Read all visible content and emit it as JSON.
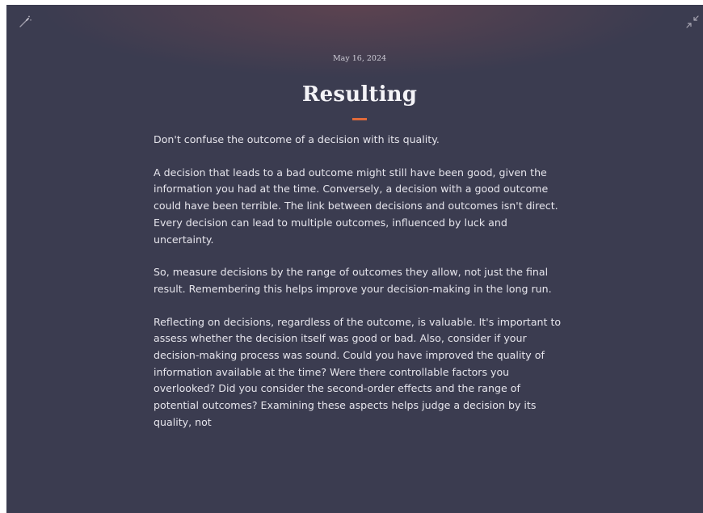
{
  "toolbar": {
    "left_icon": "magic-wand-icon",
    "right_icon": "collapse-arrows-icon"
  },
  "article": {
    "date": "May 16, 2024",
    "title": "Resulting",
    "divider_color": "#e06a3a",
    "paragraphs": [
      "Don't confuse the outcome of a decision with its quality.",
      "A decision that leads to a bad outcome might still have been good, given the information you had at the time. Conversely, a decision with a good outcome could have been terrible. The link between decisions and outcomes isn't direct. Every decision can lead to multiple outcomes, influenced by luck and uncertainty.",
      "So, measure decisions by the range of outcomes they allow, not just the final result. Remembering this helps improve your decision-making in the long run.",
      "Reflecting on decisions, regardless of the outcome, is valuable. It's important to assess whether the decision itself was good or bad. Also, consider if your decision-making process was sound. Could you have improved the quality of information available at the time? Were there controllable factors you overlooked? Did you consider the second-order effects and the range of potential outcomes? Examining these aspects helps judge a decision by its quality, not"
    ]
  },
  "colors": {
    "background": "#3b3c50",
    "text": "#e6e5ec",
    "accent": "#e06a3a"
  }
}
